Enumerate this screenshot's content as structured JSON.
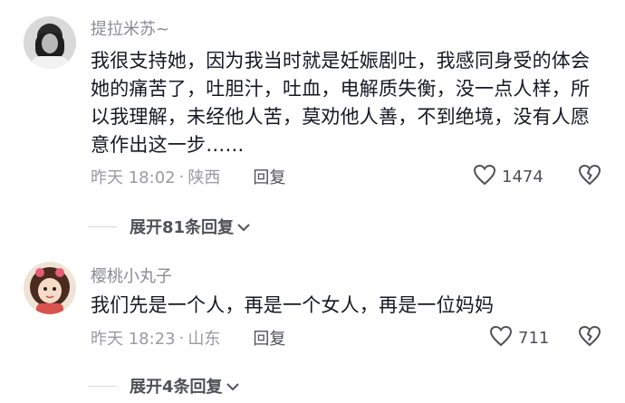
{
  "comments": [
    {
      "username": "提拉米苏~",
      "text": "我很支持她，因为我当时就是妊娠剧吐，我感同身受的体会她的痛苦了，吐胆汁，吐血，电解质失衡，没一点人样，所以我理解，未经他人苦，莫劝他人善，不到绝境，没有人愿意作出这一步……",
      "time": "昨天 18:02",
      "location": "陕西",
      "reply_label": "回复",
      "likes": "1474",
      "expand_label": "展开81条回复"
    },
    {
      "username": "樱桃小丸子",
      "text": "我们先是一个人，再是一个女人，再是一位妈妈",
      "time": "昨天 18:23",
      "location": "山东",
      "reply_label": "回复",
      "likes": "711",
      "expand_label": "展开4条回复"
    }
  ],
  "separator": "·",
  "icons": [
    "heart-icon",
    "broken-heart-icon",
    "chevron-down-icon"
  ],
  "colors": {
    "text": "#161823",
    "meta": "#9a9ba1",
    "username": "#8a8b91",
    "action": "#505158"
  }
}
